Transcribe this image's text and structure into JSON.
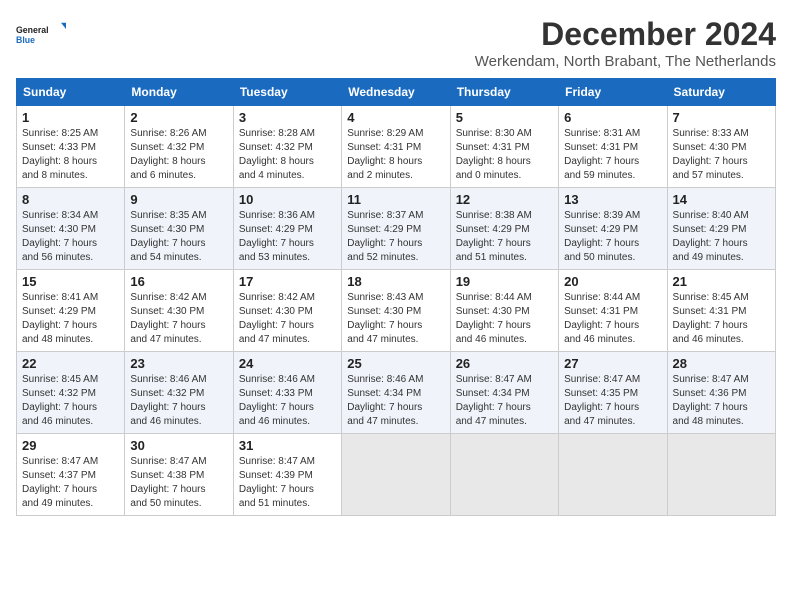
{
  "header": {
    "logo_line1": "General",
    "logo_line2": "Blue",
    "month_title": "December 2024",
    "location": "Werkendam, North Brabant, The Netherlands"
  },
  "weekdays": [
    "Sunday",
    "Monday",
    "Tuesday",
    "Wednesday",
    "Thursday",
    "Friday",
    "Saturday"
  ],
  "weeks": [
    [
      {
        "day": "1",
        "info": "Sunrise: 8:25 AM\nSunset: 4:33 PM\nDaylight: 8 hours\nand 8 minutes."
      },
      {
        "day": "2",
        "info": "Sunrise: 8:26 AM\nSunset: 4:32 PM\nDaylight: 8 hours\nand 6 minutes."
      },
      {
        "day": "3",
        "info": "Sunrise: 8:28 AM\nSunset: 4:32 PM\nDaylight: 8 hours\nand 4 minutes."
      },
      {
        "day": "4",
        "info": "Sunrise: 8:29 AM\nSunset: 4:31 PM\nDaylight: 8 hours\nand 2 minutes."
      },
      {
        "day": "5",
        "info": "Sunrise: 8:30 AM\nSunset: 4:31 PM\nDaylight: 8 hours\nand 0 minutes."
      },
      {
        "day": "6",
        "info": "Sunrise: 8:31 AM\nSunset: 4:31 PM\nDaylight: 7 hours\nand 59 minutes."
      },
      {
        "day": "7",
        "info": "Sunrise: 8:33 AM\nSunset: 4:30 PM\nDaylight: 7 hours\nand 57 minutes."
      }
    ],
    [
      {
        "day": "8",
        "info": "Sunrise: 8:34 AM\nSunset: 4:30 PM\nDaylight: 7 hours\nand 56 minutes."
      },
      {
        "day": "9",
        "info": "Sunrise: 8:35 AM\nSunset: 4:30 PM\nDaylight: 7 hours\nand 54 minutes."
      },
      {
        "day": "10",
        "info": "Sunrise: 8:36 AM\nSunset: 4:29 PM\nDaylight: 7 hours\nand 53 minutes."
      },
      {
        "day": "11",
        "info": "Sunrise: 8:37 AM\nSunset: 4:29 PM\nDaylight: 7 hours\nand 52 minutes."
      },
      {
        "day": "12",
        "info": "Sunrise: 8:38 AM\nSunset: 4:29 PM\nDaylight: 7 hours\nand 51 minutes."
      },
      {
        "day": "13",
        "info": "Sunrise: 8:39 AM\nSunset: 4:29 PM\nDaylight: 7 hours\nand 50 minutes."
      },
      {
        "day": "14",
        "info": "Sunrise: 8:40 AM\nSunset: 4:29 PM\nDaylight: 7 hours\nand 49 minutes."
      }
    ],
    [
      {
        "day": "15",
        "info": "Sunrise: 8:41 AM\nSunset: 4:29 PM\nDaylight: 7 hours\nand 48 minutes."
      },
      {
        "day": "16",
        "info": "Sunrise: 8:42 AM\nSunset: 4:30 PM\nDaylight: 7 hours\nand 47 minutes."
      },
      {
        "day": "17",
        "info": "Sunrise: 8:42 AM\nSunset: 4:30 PM\nDaylight: 7 hours\nand 47 minutes."
      },
      {
        "day": "18",
        "info": "Sunrise: 8:43 AM\nSunset: 4:30 PM\nDaylight: 7 hours\nand 47 minutes."
      },
      {
        "day": "19",
        "info": "Sunrise: 8:44 AM\nSunset: 4:30 PM\nDaylight: 7 hours\nand 46 minutes."
      },
      {
        "day": "20",
        "info": "Sunrise: 8:44 AM\nSunset: 4:31 PM\nDaylight: 7 hours\nand 46 minutes."
      },
      {
        "day": "21",
        "info": "Sunrise: 8:45 AM\nSunset: 4:31 PM\nDaylight: 7 hours\nand 46 minutes."
      }
    ],
    [
      {
        "day": "22",
        "info": "Sunrise: 8:45 AM\nSunset: 4:32 PM\nDaylight: 7 hours\nand 46 minutes."
      },
      {
        "day": "23",
        "info": "Sunrise: 8:46 AM\nSunset: 4:32 PM\nDaylight: 7 hours\nand 46 minutes."
      },
      {
        "day": "24",
        "info": "Sunrise: 8:46 AM\nSunset: 4:33 PM\nDaylight: 7 hours\nand 46 minutes."
      },
      {
        "day": "25",
        "info": "Sunrise: 8:46 AM\nSunset: 4:34 PM\nDaylight: 7 hours\nand 47 minutes."
      },
      {
        "day": "26",
        "info": "Sunrise: 8:47 AM\nSunset: 4:34 PM\nDaylight: 7 hours\nand 47 minutes."
      },
      {
        "day": "27",
        "info": "Sunrise: 8:47 AM\nSunset: 4:35 PM\nDaylight: 7 hours\nand 47 minutes."
      },
      {
        "day": "28",
        "info": "Sunrise: 8:47 AM\nSunset: 4:36 PM\nDaylight: 7 hours\nand 48 minutes."
      }
    ],
    [
      {
        "day": "29",
        "info": "Sunrise: 8:47 AM\nSunset: 4:37 PM\nDaylight: 7 hours\nand 49 minutes."
      },
      {
        "day": "30",
        "info": "Sunrise: 8:47 AM\nSunset: 4:38 PM\nDaylight: 7 hours\nand 50 minutes."
      },
      {
        "day": "31",
        "info": "Sunrise: 8:47 AM\nSunset: 4:39 PM\nDaylight: 7 hours\nand 51 minutes."
      },
      null,
      null,
      null,
      null
    ]
  ]
}
